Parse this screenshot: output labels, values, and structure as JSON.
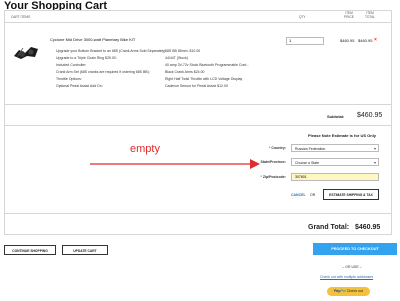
{
  "page": {
    "title": "Your Shopping Cart"
  },
  "table_header": {
    "items": "Cart Items",
    "qty": "Qty",
    "price": "Item Price",
    "total": "Item Total"
  },
  "product": {
    "name": "Cyclone Mid Drive 3000-watt Planetary Bike KIT",
    "qty": "1",
    "price": "$460.95",
    "total": "$460.95",
    "remove_glyph": "×",
    "options": [
      {
        "label": "Upgrade your Bottom Bracket to an 68S (Crank Arms Sold Separately):",
        "value": "68S BB 85mm: $10.00"
      },
      {
        "label": "Upgrade to a Triple Chain Ring $25.00:",
        "value": "44/44T (Stock)"
      },
      {
        "label": "Included Controller:",
        "value": "40 amp 3V-72v Stock Bluetooth Programmable Cont..."
      },
      {
        "label": "Crank Arm Set (68S cranks are required if ordering 68S BB):",
        "value": "Black Crank Arms $24.00"
      },
      {
        "label": "Throttle Options:",
        "value": "Right Half Twist Throttle with LCD Voltage Display"
      },
      {
        "label": "Optional Pedal Assist Add On:",
        "value": "Cadence Sensor for Pedal Assist $12.00"
      }
    ]
  },
  "subtotal": {
    "label": "Subtotal:",
    "value": "$460.95"
  },
  "shipping": {
    "note": "Please Note Estimate is for US Only",
    "country_label": "Country:",
    "country_value": "Russian Federation",
    "state_label": "State/Province:",
    "state_value": "Choose a State",
    "zip_label": "Zip/Postcode:",
    "zip_value": "307601",
    "cancel_label": "CANCEL",
    "or_label": "OR",
    "estimate_label": "ESTIMATE SHIPPING & TAX",
    "required_mark": "*"
  },
  "grand_total": {
    "label": "Grand Total:",
    "value": "$460.95"
  },
  "annotation": {
    "text": "empty",
    "color": "#e22b2b"
  },
  "actions": {
    "continue_label": "CONTINUE SHOPPING",
    "update_label": "UPDATE CART",
    "checkout_label": "PROCEED TO CHECKOUT",
    "or_use_label": "-- OR USE --",
    "multi_label": "Check out with multiple addresses",
    "paypal_a": "Pay",
    "paypal_b": "Pal",
    "paypal_c": "Check out"
  },
  "colors": {
    "accent": "#33a2ef",
    "remove": "#d9322b",
    "paypal": "#f4c13c",
    "link": "#2a6ebb"
  },
  "icons": {
    "remove": "close-icon",
    "dropdown": "chevron-down-icon",
    "product": "bike-kit-image"
  }
}
